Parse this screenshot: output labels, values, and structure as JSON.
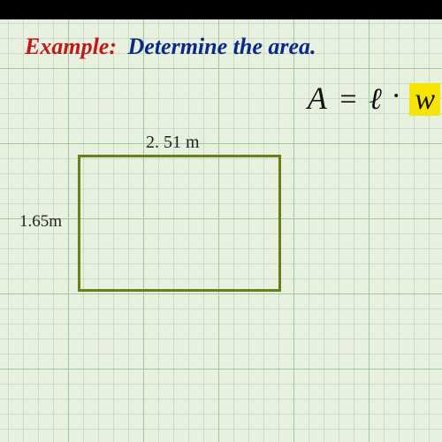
{
  "title": {
    "example_label": "Example:",
    "task_text": "Determine the area."
  },
  "formula": {
    "a": "A",
    "eq": "=",
    "l": "ℓ",
    "dot": "·",
    "w": "w"
  },
  "rectangle": {
    "width_label": "2. 51 m",
    "height_label": "1.65m"
  },
  "chart_data": {
    "type": "diagram",
    "shape": "rectangle",
    "length": 2.51,
    "height": 1.65,
    "unit": "m",
    "formula": "A = l · w",
    "task": "Determine the area"
  }
}
